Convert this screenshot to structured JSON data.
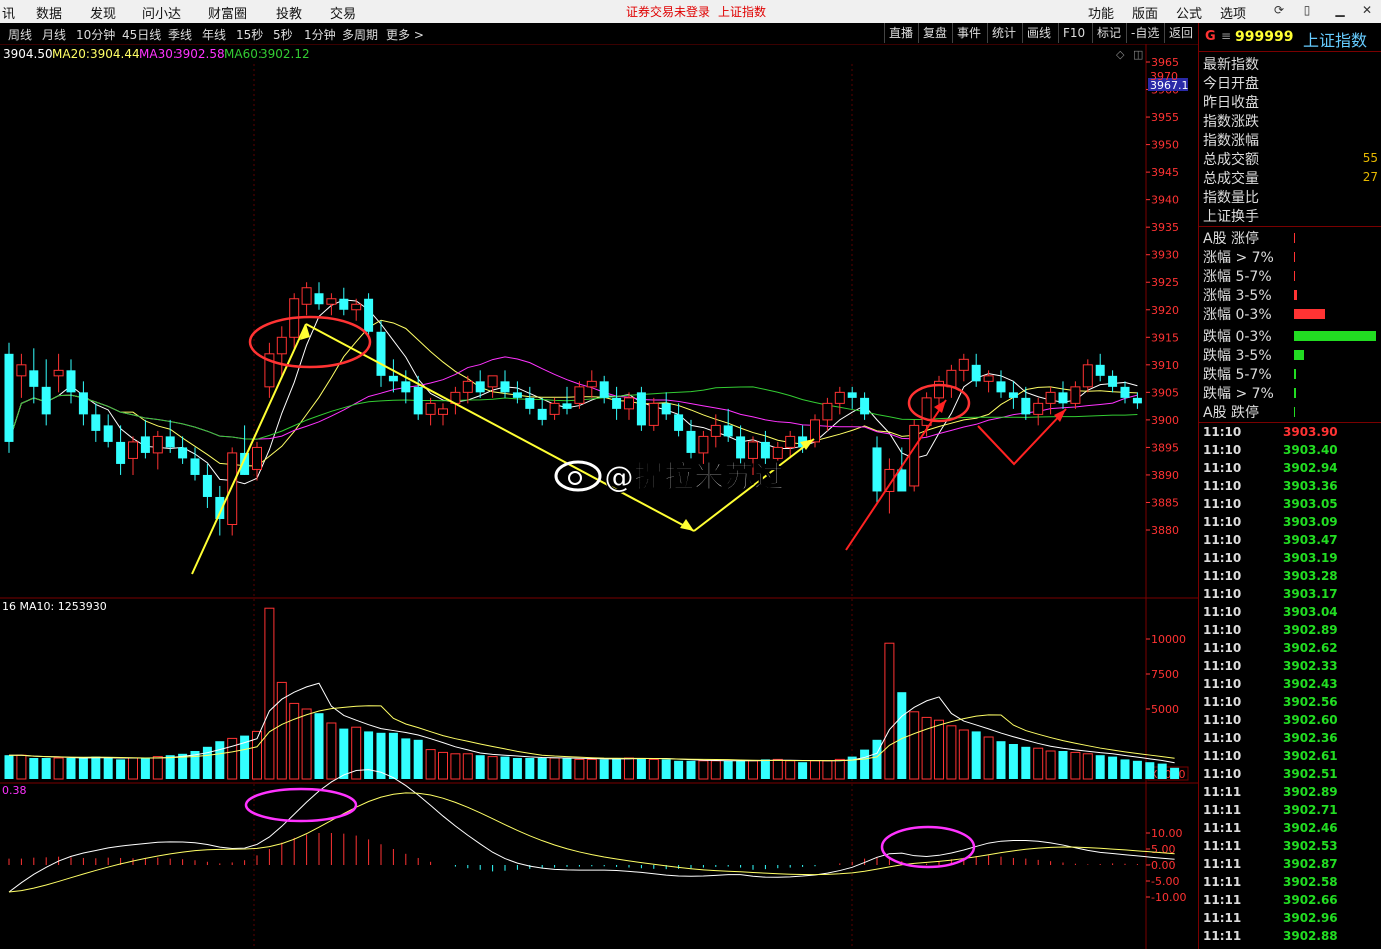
{
  "menu": {
    "left_fragment": "讯",
    "items": [
      "数据",
      "发现",
      "问小达",
      "财富圈",
      "投教",
      "交易"
    ],
    "notice_login": "证券交易未登录",
    "notice_index": "上证指数",
    "right_items": [
      "功能",
      "版面",
      "公式",
      "选项"
    ]
  },
  "periods": [
    "周线",
    "月线",
    "10分钟",
    "45日线",
    "季线",
    "年线",
    "15秒",
    "5秒",
    "1分钟",
    "多周期",
    "更多 >"
  ],
  "toolbar": [
    "直播",
    "复盘",
    "事件",
    "统计",
    "画线",
    "F10",
    "标记",
    "-自选",
    "返回"
  ],
  "ma_legend": {
    "ma10": "3904.50",
    "ma20_label": "MA20:",
    "ma20": "3904.44",
    "ma30_label": "MA30:",
    "ma30": "3902.58",
    "ma60_label": "MA60:",
    "ma60": "3902.12"
  },
  "price_axis": {
    "current_tag": "3967.1",
    "top_partial": "3970",
    "ticks": [
      "3965",
      "3960",
      "3955",
      "3950",
      "3945",
      "3940",
      "3935",
      "3930",
      "3925",
      "3920",
      "3915",
      "3910",
      "3905",
      "3900",
      "3895",
      "3890",
      "3885",
      "3880"
    ]
  },
  "volume": {
    "legend": "16  MA10: 1253930",
    "ticks": [
      "10000",
      "7500",
      "5000"
    ],
    "unit": "X1000"
  },
  "macd": {
    "legend": "0.38",
    "ticks": [
      "10.00",
      "5.00",
      "0.00",
      "-5.00",
      "-10.00"
    ]
  },
  "watermark": "@提拉米苏过",
  "colors": {
    "up": "#ff3333",
    "down": "#33ffff",
    "ma10": "#ffffff",
    "ma20": "#ffff66",
    "ma30": "#ff33ff",
    "ma60": "#33cc33",
    "arrow_yellow": "#ffff33",
    "arrow_red": "#ff2222",
    "circle_red": "#ff3333",
    "circle_magenta": "#ff33ff"
  },
  "panel": {
    "code_prefix": "G",
    "code": "999999",
    "name": "上证指数",
    "stats": [
      {
        "label": "最新指数",
        "value": ""
      },
      {
        "label": "今日开盘",
        "value": ""
      },
      {
        "label": "昨日收盘",
        "value": ""
      },
      {
        "label": "指数涨跌",
        "value": ""
      },
      {
        "label": "指数涨幅",
        "value": ""
      },
      {
        "label": "总成交额",
        "value": "55"
      },
      {
        "label": "总成交量",
        "value": "27"
      },
      {
        "label": "指数量比",
        "value": ""
      },
      {
        "label": "上证换手",
        "value": ""
      }
    ],
    "breadth": [
      {
        "label": "A股 涨停",
        "fill": 0.01,
        "color": "#ff3333"
      },
      {
        "label": "涨幅 > 7%",
        "fill": 0.01,
        "color": "#ff3333"
      },
      {
        "label": "涨幅 5-7%",
        "fill": 0.01,
        "color": "#ff3333"
      },
      {
        "label": "涨幅 3-5%",
        "fill": 0.04,
        "color": "#ff3333"
      },
      {
        "label": "涨幅 0-3%",
        "fill": 0.38,
        "color": "#ff3333"
      },
      {
        "label": "跌幅 0-3%",
        "fill": 1.0,
        "color": "#22dd22"
      },
      {
        "label": "跌幅 3-5%",
        "fill": 0.12,
        "color": "#22dd22"
      },
      {
        "label": "跌幅 5-7%",
        "fill": 0.03,
        "color": "#22dd22"
      },
      {
        "label": "跌幅 > 7%",
        "fill": 0.03,
        "color": "#22dd22"
      },
      {
        "label": "A股 跌停",
        "fill": 0.01,
        "color": "#22dd22"
      }
    ],
    "ticks": [
      {
        "t": "11:10",
        "v": "3903.90",
        "c": "#ff3333"
      },
      {
        "t": "11:10",
        "v": "3903.40",
        "c": "#22dd22"
      },
      {
        "t": "11:10",
        "v": "3902.94",
        "c": "#22dd22"
      },
      {
        "t": "11:10",
        "v": "3903.36",
        "c": "#22dd22"
      },
      {
        "t": "11:10",
        "v": "3903.05",
        "c": "#22dd22"
      },
      {
        "t": "11:10",
        "v": "3903.09",
        "c": "#22dd22"
      },
      {
        "t": "11:10",
        "v": "3903.47",
        "c": "#22dd22"
      },
      {
        "t": "11:10",
        "v": "3903.19",
        "c": "#22dd22"
      },
      {
        "t": "11:10",
        "v": "3903.28",
        "c": "#22dd22"
      },
      {
        "t": "11:10",
        "v": "3903.17",
        "c": "#22dd22"
      },
      {
        "t": "11:10",
        "v": "3903.04",
        "c": "#22dd22"
      },
      {
        "t": "11:10",
        "v": "3902.89",
        "c": "#22dd22"
      },
      {
        "t": "11:10",
        "v": "3902.62",
        "c": "#22dd22"
      },
      {
        "t": "11:10",
        "v": "3902.33",
        "c": "#22dd22"
      },
      {
        "t": "11:10",
        "v": "3902.43",
        "c": "#22dd22"
      },
      {
        "t": "11:10",
        "v": "3902.56",
        "c": "#22dd22"
      },
      {
        "t": "11:10",
        "v": "3902.60",
        "c": "#22dd22"
      },
      {
        "t": "11:10",
        "v": "3902.36",
        "c": "#22dd22"
      },
      {
        "t": "11:10",
        "v": "3902.61",
        "c": "#22dd22"
      },
      {
        "t": "11:10",
        "v": "3902.51",
        "c": "#22dd22"
      },
      {
        "t": "11:11",
        "v": "3902.89",
        "c": "#22dd22"
      },
      {
        "t": "11:11",
        "v": "3902.71",
        "c": "#22dd22"
      },
      {
        "t": "11:11",
        "v": "3902.46",
        "c": "#22dd22"
      },
      {
        "t": "11:11",
        "v": "3902.53",
        "c": "#22dd22"
      },
      {
        "t": "11:11",
        "v": "3902.87",
        "c": "#22dd22"
      },
      {
        "t": "11:11",
        "v": "3902.58",
        "c": "#22dd22"
      },
      {
        "t": "11:11",
        "v": "3902.66",
        "c": "#22dd22"
      },
      {
        "t": "11:11",
        "v": "3902.96",
        "c": "#22dd22"
      },
      {
        "t": "11:11",
        "v": "3902.88",
        "c": "#22dd22"
      }
    ]
  },
  "chart_data": {
    "type": "candlestick",
    "price_range": [
      3878,
      3972
    ],
    "candles": [
      {
        "o": 3912,
        "h": 3914,
        "l": 3894,
        "c": 3896
      },
      {
        "o": 3908,
        "h": 3912,
        "l": 3904,
        "c": 3910
      },
      {
        "o": 3909,
        "h": 3913,
        "l": 3903,
        "c": 3906
      },
      {
        "o": 3906,
        "h": 3911,
        "l": 3899,
        "c": 3901
      },
      {
        "o": 3908,
        "h": 3912,
        "l": 3905,
        "c": 3909
      },
      {
        "o": 3909,
        "h": 3911,
        "l": 3903,
        "c": 3905
      },
      {
        "o": 3905,
        "h": 3907,
        "l": 3899,
        "c": 3901
      },
      {
        "o": 3901,
        "h": 3903,
        "l": 3896,
        "c": 3898
      },
      {
        "o": 3899,
        "h": 3901,
        "l": 3895,
        "c": 3896
      },
      {
        "o": 3896,
        "h": 3899,
        "l": 3890,
        "c": 3892
      },
      {
        "o": 3893,
        "h": 3897,
        "l": 3890,
        "c": 3896
      },
      {
        "o": 3897,
        "h": 3900,
        "l": 3893,
        "c": 3894
      },
      {
        "o": 3894,
        "h": 3898,
        "l": 3891,
        "c": 3897
      },
      {
        "o": 3897,
        "h": 3900,
        "l": 3894,
        "c": 3895
      },
      {
        "o": 3895,
        "h": 3897,
        "l": 3892,
        "c": 3893
      },
      {
        "o": 3893,
        "h": 3895,
        "l": 3889,
        "c": 3890
      },
      {
        "o": 3890,
        "h": 3892,
        "l": 3884,
        "c": 3886
      },
      {
        "o": 3886,
        "h": 3888,
        "l": 3879,
        "c": 3882
      },
      {
        "o": 3881,
        "h": 3895,
        "l": 3879,
        "c": 3894
      },
      {
        "o": 3894,
        "h": 3899,
        "l": 3890,
        "c": 3890
      },
      {
        "o": 3891,
        "h": 3896,
        "l": 3889,
        "c": 3895
      },
      {
        "o": 3906,
        "h": 3914,
        "l": 3904,
        "c": 3912
      },
      {
        "o": 3912,
        "h": 3917,
        "l": 3908,
        "c": 3915
      },
      {
        "o": 3915,
        "h": 3923,
        "l": 3913,
        "c": 3922
      },
      {
        "o": 3921,
        "h": 3925,
        "l": 3919,
        "c": 3924
      },
      {
        "o": 3923,
        "h": 3925,
        "l": 3920,
        "c": 3921
      },
      {
        "o": 3921,
        "h": 3923,
        "l": 3919,
        "c": 3922
      },
      {
        "o": 3922,
        "h": 3924,
        "l": 3919,
        "c": 3920
      },
      {
        "o": 3920,
        "h": 3922,
        "l": 3918,
        "c": 3921
      },
      {
        "o": 3922,
        "h": 3923,
        "l": 3915,
        "c": 3916
      },
      {
        "o": 3916,
        "h": 3918,
        "l": 3906,
        "c": 3908
      },
      {
        "o": 3908,
        "h": 3911,
        "l": 3905,
        "c": 3907
      },
      {
        "o": 3907,
        "h": 3909,
        "l": 3903,
        "c": 3905
      },
      {
        "o": 3906,
        "h": 3908,
        "l": 3900,
        "c": 3901
      },
      {
        "o": 3901,
        "h": 3904,
        "l": 3899,
        "c": 3903
      },
      {
        "o": 3901,
        "h": 3903,
        "l": 3899,
        "c": 3902
      },
      {
        "o": 3903,
        "h": 3906,
        "l": 3901,
        "c": 3905
      },
      {
        "o": 3905,
        "h": 3908,
        "l": 3903,
        "c": 3907
      },
      {
        "o": 3907,
        "h": 3909,
        "l": 3904,
        "c": 3905
      },
      {
        "o": 3906,
        "h": 3908,
        "l": 3904,
        "c": 3908
      },
      {
        "o": 3907,
        "h": 3909,
        "l": 3904,
        "c": 3905
      },
      {
        "o": 3905,
        "h": 3907,
        "l": 3903,
        "c": 3904
      },
      {
        "o": 3904,
        "h": 3906,
        "l": 3901,
        "c": 3902
      },
      {
        "o": 3902,
        "h": 3904,
        "l": 3899,
        "c": 3900
      },
      {
        "o": 3901,
        "h": 3904,
        "l": 3900,
        "c": 3903
      },
      {
        "o": 3903,
        "h": 3906,
        "l": 3901,
        "c": 3902
      },
      {
        "o": 3903,
        "h": 3907,
        "l": 3902,
        "c": 3906
      },
      {
        "o": 3906,
        "h": 3909,
        "l": 3904,
        "c": 3907
      },
      {
        "o": 3907,
        "h": 3908,
        "l": 3903,
        "c": 3904
      },
      {
        "o": 3904,
        "h": 3906,
        "l": 3900,
        "c": 3902
      },
      {
        "o": 3902,
        "h": 3905,
        "l": 3900,
        "c": 3904
      },
      {
        "o": 3905,
        "h": 3906,
        "l": 3898,
        "c": 3899
      },
      {
        "o": 3899,
        "h": 3904,
        "l": 3898,
        "c": 3903
      },
      {
        "o": 3903,
        "h": 3905,
        "l": 3900,
        "c": 3901
      },
      {
        "o": 3901,
        "h": 3903,
        "l": 3897,
        "c": 3898
      },
      {
        "o": 3898,
        "h": 3900,
        "l": 3893,
        "c": 3894
      },
      {
        "o": 3894,
        "h": 3898,
        "l": 3892,
        "c": 3897
      },
      {
        "o": 3897,
        "h": 3901,
        "l": 3895,
        "c": 3899
      },
      {
        "o": 3899,
        "h": 3902,
        "l": 3896,
        "c": 3897
      },
      {
        "o": 3897,
        "h": 3899,
        "l": 3892,
        "c": 3893
      },
      {
        "o": 3893,
        "h": 3897,
        "l": 3890,
        "c": 3896
      },
      {
        "o": 3896,
        "h": 3898,
        "l": 3892,
        "c": 3893
      },
      {
        "o": 3893,
        "h": 3896,
        "l": 3891,
        "c": 3895
      },
      {
        "o": 3895,
        "h": 3898,
        "l": 3893,
        "c": 3897
      },
      {
        "o": 3897,
        "h": 3899,
        "l": 3894,
        "c": 3895
      },
      {
        "o": 3896,
        "h": 3901,
        "l": 3895,
        "c": 3900
      },
      {
        "o": 3900,
        "h": 3904,
        "l": 3898,
        "c": 3903
      },
      {
        "o": 3903,
        "h": 3906,
        "l": 3901,
        "c": 3905
      },
      {
        "o": 3905,
        "h": 3906,
        "l": 3902,
        "c": 3904
      },
      {
        "o": 3904,
        "h": 3905,
        "l": 3900,
        "c": 3901
      },
      {
        "o": 3895,
        "h": 3897,
        "l": 3885,
        "c": 3887
      },
      {
        "o": 3887,
        "h": 3893,
        "l": 3883,
        "c": 3891
      },
      {
        "o": 3891,
        "h": 3895,
        "l": 3889,
        "c": 3887
      },
      {
        "o": 3888,
        "h": 3900,
        "l": 3887,
        "c": 3899
      },
      {
        "o": 3899,
        "h": 3905,
        "l": 3897,
        "c": 3904
      },
      {
        "o": 3904,
        "h": 3908,
        "l": 3902,
        "c": 3907
      },
      {
        "o": 3906,
        "h": 3910,
        "l": 3904,
        "c": 3909
      },
      {
        "o": 3909,
        "h": 3912,
        "l": 3907,
        "c": 3911
      },
      {
        "o": 3910,
        "h": 3912,
        "l": 3906,
        "c": 3907
      },
      {
        "o": 3907,
        "h": 3909,
        "l": 3905,
        "c": 3908
      },
      {
        "o": 3907,
        "h": 3909,
        "l": 3904,
        "c": 3905
      },
      {
        "o": 3905,
        "h": 3907,
        "l": 3902,
        "c": 3904
      },
      {
        "o": 3904,
        "h": 3906,
        "l": 3900,
        "c": 3901
      },
      {
        "o": 3901,
        "h": 3904,
        "l": 3899,
        "c": 3903
      },
      {
        "o": 3903,
        "h": 3906,
        "l": 3901,
        "c": 3905
      },
      {
        "o": 3905,
        "h": 3907,
        "l": 3902,
        "c": 3903
      },
      {
        "o": 3903,
        "h": 3907,
        "l": 3902,
        "c": 3906
      },
      {
        "o": 3906,
        "h": 3911,
        "l": 3905,
        "c": 3910
      },
      {
        "o": 3910,
        "h": 3912,
        "l": 3907,
        "c": 3908
      },
      {
        "o": 3908,
        "h": 3909,
        "l": 3905,
        "c": 3906
      },
      {
        "o": 3906,
        "h": 3907,
        "l": 3903,
        "c": 3904
      },
      {
        "o": 3904,
        "h": 3905,
        "l": 3902,
        "c": 3903
      }
    ],
    "volume_range": [
      0,
      12500
    ],
    "volumes": [
      1700,
      1700,
      1500,
      1500,
      1500,
      1500,
      1500,
      1600,
      1500,
      1400,
      1500,
      1500,
      1600,
      1700,
      1800,
      2000,
      2300,
      2700,
      2900,
      3100,
      3400,
      12200,
      6900,
      5400,
      5000,
      4700,
      4000,
      3600,
      3700,
      3400,
      3300,
      3300,
      2900,
      2800,
      2100,
      1900,
      1800,
      1800,
      1700,
      1600,
      1600,
      1500,
      1500,
      1500,
      1500,
      1500,
      1400,
      1400,
      1400,
      1500,
      1500,
      1500,
      1400,
      1400,
      1300,
      1300,
      1300,
      1300,
      1300,
      1300,
      1300,
      1400,
      1400,
      1300,
      1200,
      1300,
      1300,
      1400,
      1600,
      2100,
      2800,
      9700,
      6200,
      4800,
      4400,
      4200,
      3800,
      3500,
      3400,
      3000,
      2700,
      2500,
      2300,
      2200,
      2000,
      2000,
      1900,
      1800,
      1700,
      1600,
      1400,
      1300,
      1200,
      1100,
      800
    ],
    "macd_range": [
      -12,
      12
    ],
    "macd_hist": [
      2,
      2,
      2.3,
      2.4,
      2.6,
      2.4,
      2.2,
      2.1,
      2.3,
      2.2,
      2.1,
      2.2,
      2.3,
      2,
      1.8,
      1.5,
      1,
      0.5,
      0.8,
      1.5,
      3,
      5,
      7,
      8.5,
      9.5,
      10,
      10,
      9.8,
      9.2,
      8,
      6.5,
      5,
      3.5,
      2.2,
      1,
      0,
      -0.5,
      -1,
      -1.5,
      -2,
      -1.8,
      -1.5,
      -1.2,
      -1,
      -0.8,
      -0.6,
      -0.5,
      -0.4,
      -0.4,
      -0.6,
      -0.8,
      -1,
      -1.2,
      -1.3,
      -1.2,
      -1,
      -0.8,
      -0.6,
      -0.5,
      -0.8,
      -1.5,
      -1.3,
      -1,
      -0.8,
      -0.6,
      -0.4,
      0,
      0.5,
      1,
      2,
      2.5,
      2.2,
      1.2,
      -0.2,
      0.4,
      1.2,
      1.8,
      2.3,
      2.8,
      3,
      2.6,
      2.2,
      2,
      1.6,
      1.2,
      0.8,
      0.4,
      0.2,
      0.3,
      0.5,
      0.4,
      0.3,
      0.2,
      0.1,
      0.1
    ]
  }
}
